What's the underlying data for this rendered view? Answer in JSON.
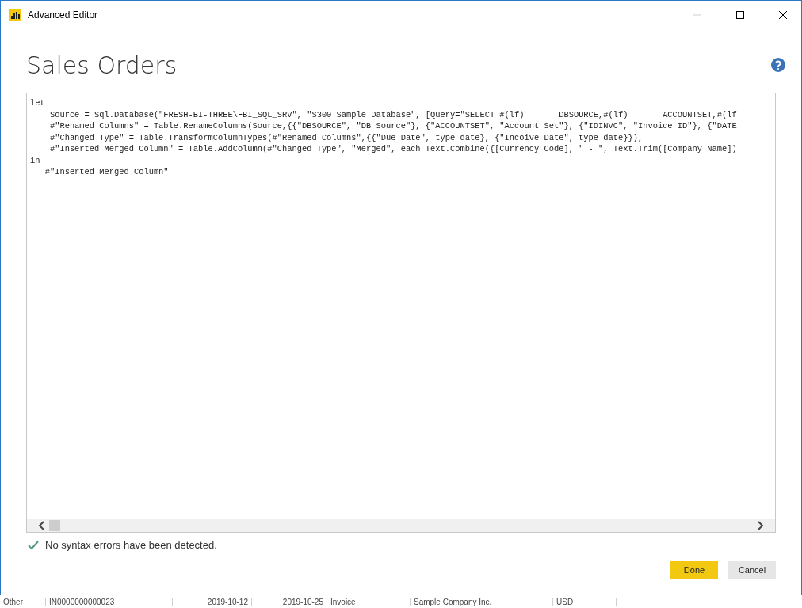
{
  "window": {
    "title": "Advanced Editor"
  },
  "query_title": "Sales Orders",
  "code_lines": [
    "let",
    "    Source = Sql.Database(\"FRESH-BI-THREE\\FBI_SQL_SRV\", \"S300 Sample Database\", [Query=\"SELECT #(lf)       DBSOURCE,#(lf)       ACCOUNTSET,#(lf",
    "    #\"Renamed Columns\" = Table.RenameColumns(Source,{{\"DBSOURCE\", \"DB Source\"}, {\"ACCOUNTSET\", \"Account Set\"}, {\"IDINVC\", \"Invoice ID\"}, {\"DATE",
    "    #\"Changed Type\" = Table.TransformColumnTypes(#\"Renamed Columns\",{{\"Due Date\", type date}, {\"Incoive Date\", type date}}),",
    "    #\"Inserted Merged Column\" = Table.AddColumn(#\"Changed Type\", \"Merged\", each Text.Combine({[Currency Code], \" - \", Text.Trim([Company Name])",
    "in",
    "   #\"Inserted Merged Column\""
  ],
  "status": {
    "ok": true,
    "message": "No syntax errors have been detected."
  },
  "buttons": [
    {
      "label": "Done",
      "primary": true
    },
    {
      "label": "Cancel",
      "primary": false
    }
  ],
  "background_row": [
    "Other",
    "IN0000000000023",
    "2019-10-12",
    "2019-10-25",
    "Invoice",
    "Sample Company Inc.",
    "USD"
  ]
}
